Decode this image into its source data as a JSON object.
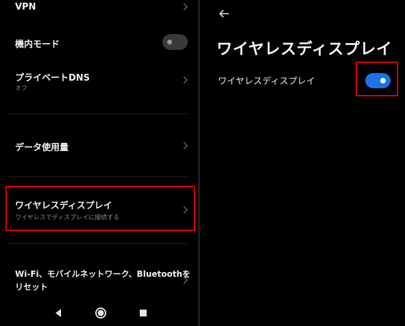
{
  "left_panel": {
    "items": [
      {
        "title": "VPN",
        "subtitle": ""
      },
      {
        "title": "機内モード",
        "subtitle": "",
        "toggle_on": false
      },
      {
        "title": "プライベートDNS",
        "subtitle": "オフ"
      },
      {
        "title": "データ使用量",
        "subtitle": ""
      },
      {
        "title": "ワイヤレスディスプレイ",
        "subtitle": "ワイヤレスでディスプレイに接続する"
      },
      {
        "title_line1": "Wi-Fi、モバイルネットワーク、Bluetoothを",
        "title_line2": "リセット"
      }
    ]
  },
  "nav": {
    "back": "back-icon",
    "home": "home-icon",
    "recents": "recents-icon"
  },
  "right_panel": {
    "back_icon": "arrow-left-icon",
    "title": "ワイヤレスディスプレイ",
    "setting_label": "ワイヤレスディスプレイ",
    "toggle_on": true
  },
  "colors": {
    "accent": "#1a73e8",
    "highlight": "#e00000",
    "background": "#000000"
  }
}
